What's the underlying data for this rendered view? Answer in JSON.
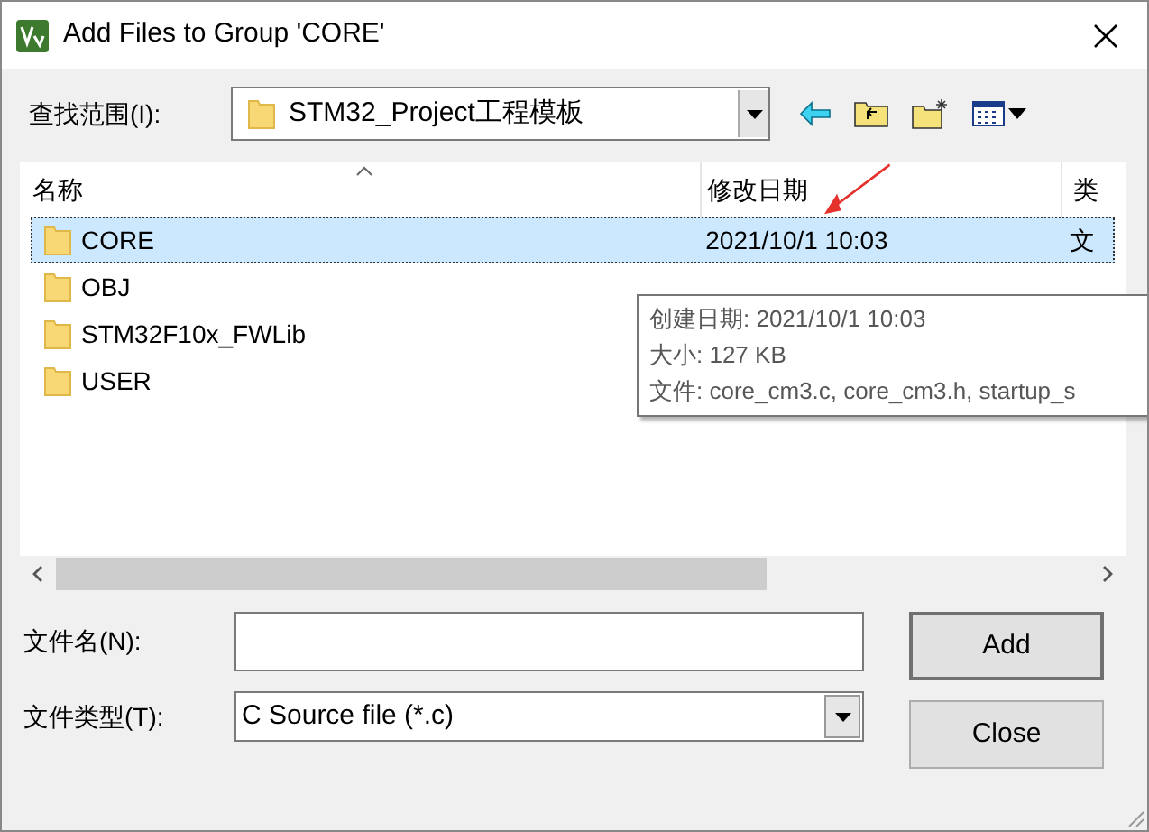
{
  "window": {
    "title": "Add Files to Group 'CORE'"
  },
  "look_in": {
    "label": "查找范围(I):",
    "value": "STM32_Project工程模板"
  },
  "file_list": {
    "columns": [
      "名称",
      "修改日期",
      "类"
    ],
    "rows": [
      {
        "name": "CORE",
        "date": "2021/10/1 10:03",
        "type": "文",
        "selected": true
      },
      {
        "name": "OBJ",
        "selected": false
      },
      {
        "name": "STM32F10x_FWLib",
        "selected": false
      },
      {
        "name": "USER",
        "selected": false
      }
    ]
  },
  "tooltip": {
    "lines": [
      "创建日期: 2021/10/1 10:03",
      "大小: 127 KB",
      "文件: core_cm3.c, core_cm3.h, startup_s"
    ]
  },
  "file_name": {
    "label": "文件名(N):"
  },
  "file_type": {
    "label": "文件类型(T):",
    "value": "C Source file (*.c)"
  },
  "buttons": [
    "Add",
    "Close"
  ]
}
